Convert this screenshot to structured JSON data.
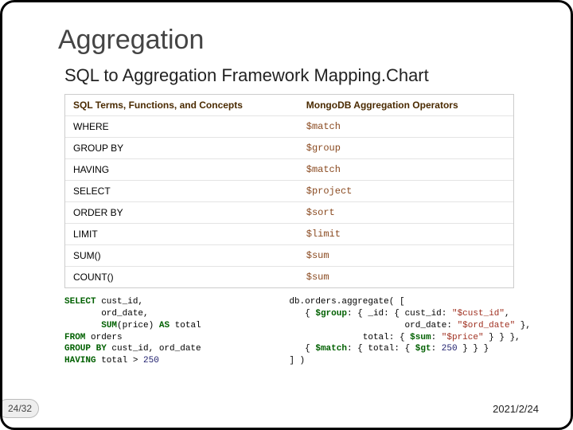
{
  "title": "Aggregation",
  "subtitle": "SQL to Aggregation Framework Mapping.Chart",
  "headers": {
    "left": "SQL Terms, Functions, and Concepts",
    "right": "MongoDB Aggregation Operators"
  },
  "rows": [
    {
      "sql": "WHERE",
      "mongo": "$match"
    },
    {
      "sql": "GROUP BY",
      "mongo": "$group"
    },
    {
      "sql": "HAVING",
      "mongo": "$match"
    },
    {
      "sql": "SELECT",
      "mongo": "$project"
    },
    {
      "sql": "ORDER BY",
      "mongo": "$sort"
    },
    {
      "sql": "LIMIT",
      "mongo": "$limit"
    },
    {
      "sql": "SUM()",
      "mongo": "$sum"
    },
    {
      "sql": "COUNT()",
      "mongo": "$sum"
    }
  ],
  "example": {
    "sql": {
      "l1a": "SELECT",
      "l1b": " cust_id,",
      "l2": "       ord_date,",
      "l3a": "       ",
      "l3b": "SUM",
      "l3c": "(price) ",
      "l3d": "AS",
      "l3e": " total",
      "l4a": "FROM",
      "l4b": " orders",
      "l5a": "GROUP BY",
      "l5b": " cust_id, ord_date",
      "l6a": "HAVING",
      "l6b": " total > ",
      "l6c": "250"
    },
    "mongo": {
      "l1": "db.orders.aggregate( [",
      "l2a": "   { ",
      "l2b": "$group",
      "l2c": ": { _id: { cust_id: ",
      "l2d": "\"$cust_id\"",
      "l2e": ",",
      "l3a": "                      ord_date: ",
      "l3b": "\"$ord_date\"",
      "l3c": " },",
      "l4a": "              total: { ",
      "l4b": "$sum",
      "l4c": ": ",
      "l4d": "\"$price\"",
      "l4e": " } } },",
      "l5a": "   { ",
      "l5b": "$match",
      "l5c": ": { total: { ",
      "l5d": "$gt",
      "l5e": ": ",
      "l5f": "250",
      "l5g": " } } }",
      "l6": "] )"
    }
  },
  "pageno": "24/32",
  "date": "2021/2/24"
}
